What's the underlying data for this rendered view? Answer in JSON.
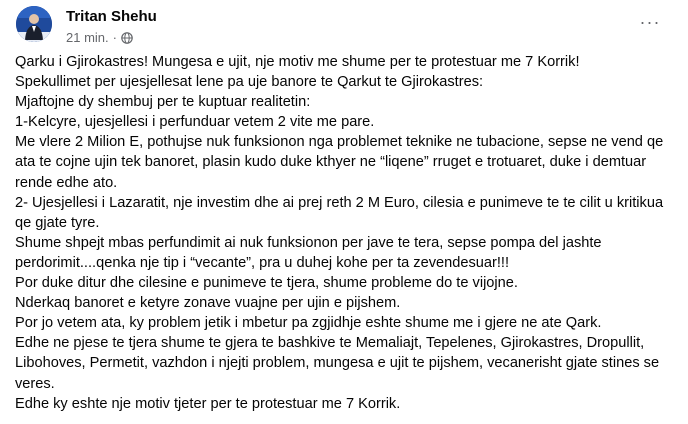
{
  "post": {
    "author": "Tritan Shehu",
    "timestamp": "21 min.",
    "separator": "·",
    "privacy_icon": "globe-icon",
    "more_icon": "more-options-icon",
    "more_label": "···",
    "lines": [
      "Qarku i Gjirokastres! Mungesa e ujit, nje motiv me shume per te protestuar me 7 Korrik!",
      "Spekullimet per ujesjellesat lene pa uje banore te Qarkut te Gjirokastres:",
      "Mjaftojne dy shembuj per te kuptuar realitetin:",
      "1-Kelcyre, ujesjellesi i perfunduar vetem 2 vite me pare.",
      "Me vlere 2 Milion E, pothujse nuk funksionon nga problemet teknike ne tubacione, sepse ne vend qe ata te cojne ujin tek banoret, plasin kudo duke kthyer ne “liqene” rruget e trotuaret, duke i demtuar rende edhe ato.",
      "2- Ujesjellesi i Lazaratit, nje investim dhe ai prej reth 2 M Euro, cilesia e punimeve te te cilit u kritikua qe gjate tyre.",
      "Shume shpejt mbas perfundimit ai nuk funksionon per jave te tera, sepse pompa del jashte perdorimit....qenka nje tip i “vecante”, pra u duhej kohe per ta zevendesuar!!!",
      "Por duke ditur dhe cilesine e punimeve te tjera, shume probleme do te vijojne.",
      "Nderkaq banoret e ketyre zonave vuajne per ujin e pijshem.",
      "Por jo vetem ata, ky problem jetik i mbetur pa zgjidhje eshte shume me i gjere ne ate Qark.",
      "Edhe ne pjese te tjera shume te gjera te bashkive te Memaliajt, Tepelenes, Gjirokastres, Dropullit, Libohoves, Permetit, vazhdon i njejti problem, mungesa e ujit te pijshem, vecanerisht gjate stines se veres.",
      "Edhe ky eshte nje motiv tjeter per te protestuar me 7 Korrik."
    ]
  }
}
